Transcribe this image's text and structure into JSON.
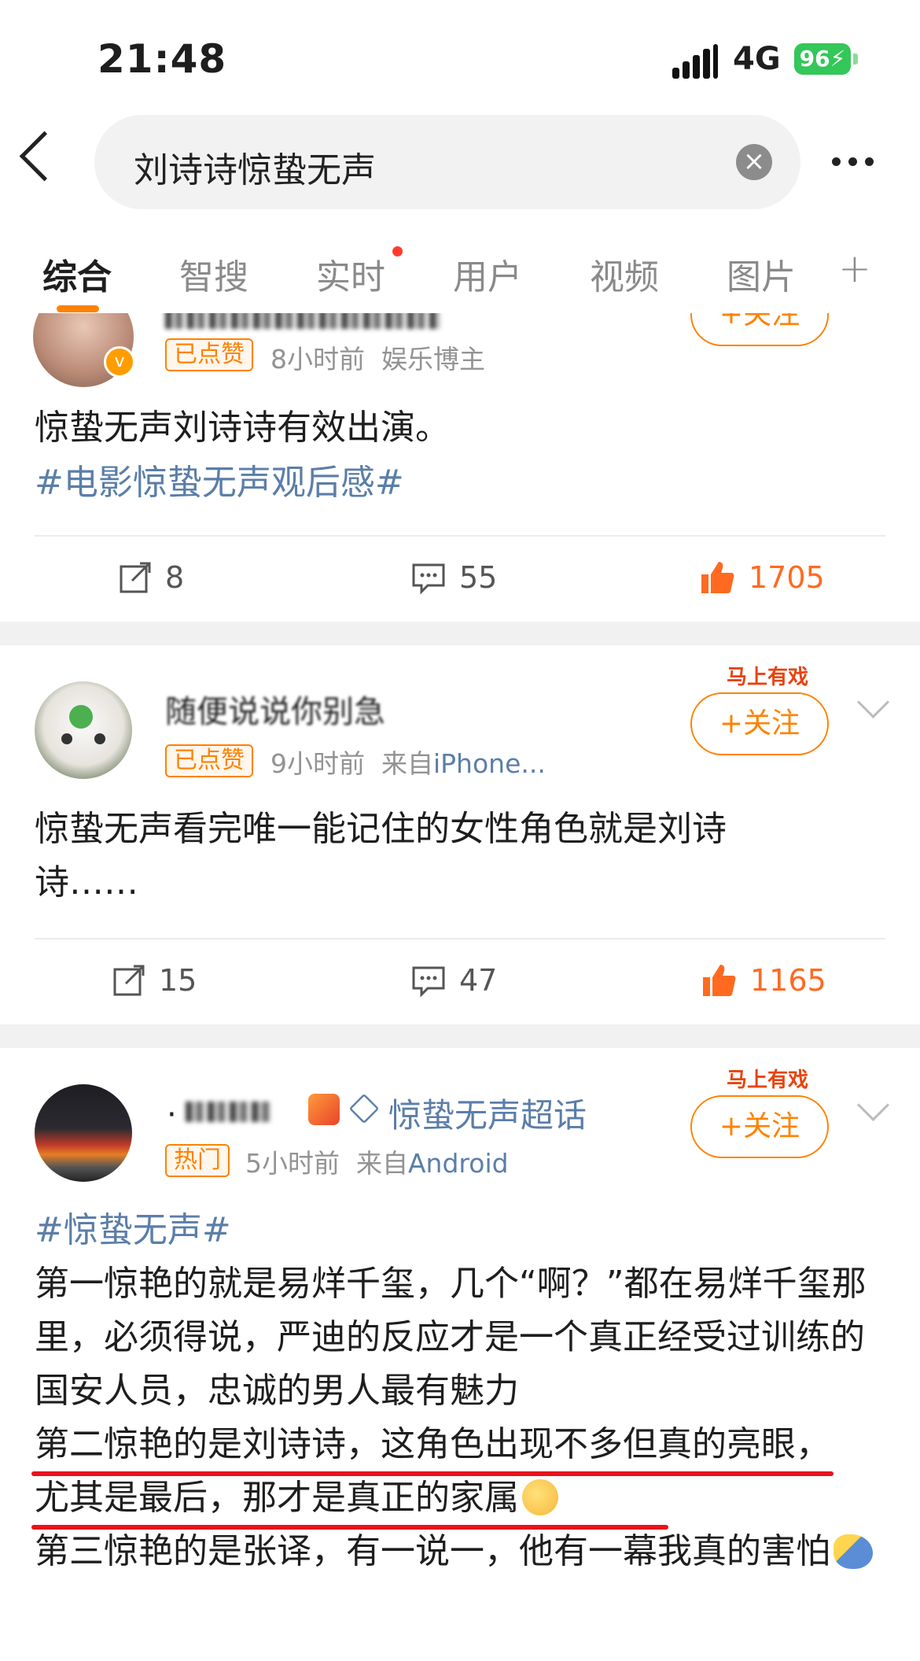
{
  "status_bar": {
    "time": "21:48",
    "network": "4G",
    "battery": "96"
  },
  "search": {
    "query": "刘诗诗惊蛰无声"
  },
  "tabs": [
    {
      "label": "综合"
    },
    {
      "label": "智搜"
    },
    {
      "label": "实时"
    },
    {
      "label": "用户"
    },
    {
      "label": "视频"
    },
    {
      "label": "图片"
    }
  ],
  "posts": [
    {
      "badge": "已点赞",
      "meta_time": "8小时前",
      "meta_source": "娱乐博主",
      "follow": "+关注",
      "text": "惊蛰无声刘诗诗有效出演。",
      "topic": "#电影惊蛰无声观后感#",
      "reposts": "8",
      "comments": "55",
      "likes": "1705"
    },
    {
      "name": "随便说说你别急",
      "badge": "已点赞",
      "meta_time": "9小时前",
      "meta_from": "来自",
      "meta_device": "iPhone...",
      "hot_label": "马上有戏",
      "follow": "+关注",
      "text": "惊蛰无声看完唯一能记住的女性角色就是刘诗诗……",
      "reposts": "15",
      "comments": "47",
      "likes": "1165"
    },
    {
      "name": "·",
      "supertopic": "惊蛰无声超话",
      "badge": "热门",
      "meta_time": "5小时前",
      "meta_from": "来自",
      "meta_device": "Android",
      "hot_label": "马上有戏",
      "follow": "+关注",
      "topic": "#惊蛰无声#",
      "para1": "第一惊艳的就是易烊千玺，几个“啊？”都在易烊千玺那里，必须得说，严迪的反应才是一个真正经受过训练的国安人员，忠诚的男人最有魅力",
      "para2": "第二惊艳的是刘诗诗，这角色出现不多但真的亮眼，尤其是最后，那才是真正的家属",
      "para3": "第三惊艳的是张译，有一说一，他有一幕我真的害怕"
    }
  ],
  "colors": {
    "accent": "#ff8200",
    "link": "#5b7ea8",
    "like": "#ff6a20",
    "underline": "#e8121b"
  }
}
